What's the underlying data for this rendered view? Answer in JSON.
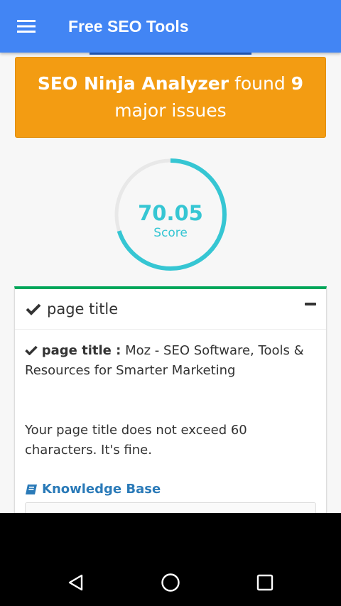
{
  "appbar": {
    "title": "Free SEO Tools",
    "menu_icon": "hamburger-menu-icon"
  },
  "banner": {
    "tool_name": "SEO Ninja Analyzer",
    "found_text": "found",
    "issue_count": "9",
    "issues_text": "major issues"
  },
  "score": {
    "value": "70.05",
    "label": "Score",
    "fraction": 0.7005,
    "color": "#36c6d3"
  },
  "panel": {
    "title": "page title",
    "detail_label": "page title :",
    "detail_value": "Moz - SEO Software, Tools & Resources for Smarter Marketing",
    "description": "Your page title does not exceed 60 characters. It's fine.",
    "knowledge_base": "Knowledge Base",
    "accent": "#00a65a"
  },
  "navigation": {
    "back_icon": "back-triangle-icon",
    "home_icon": "home-circle-icon",
    "recents_icon": "recents-square-icon"
  }
}
